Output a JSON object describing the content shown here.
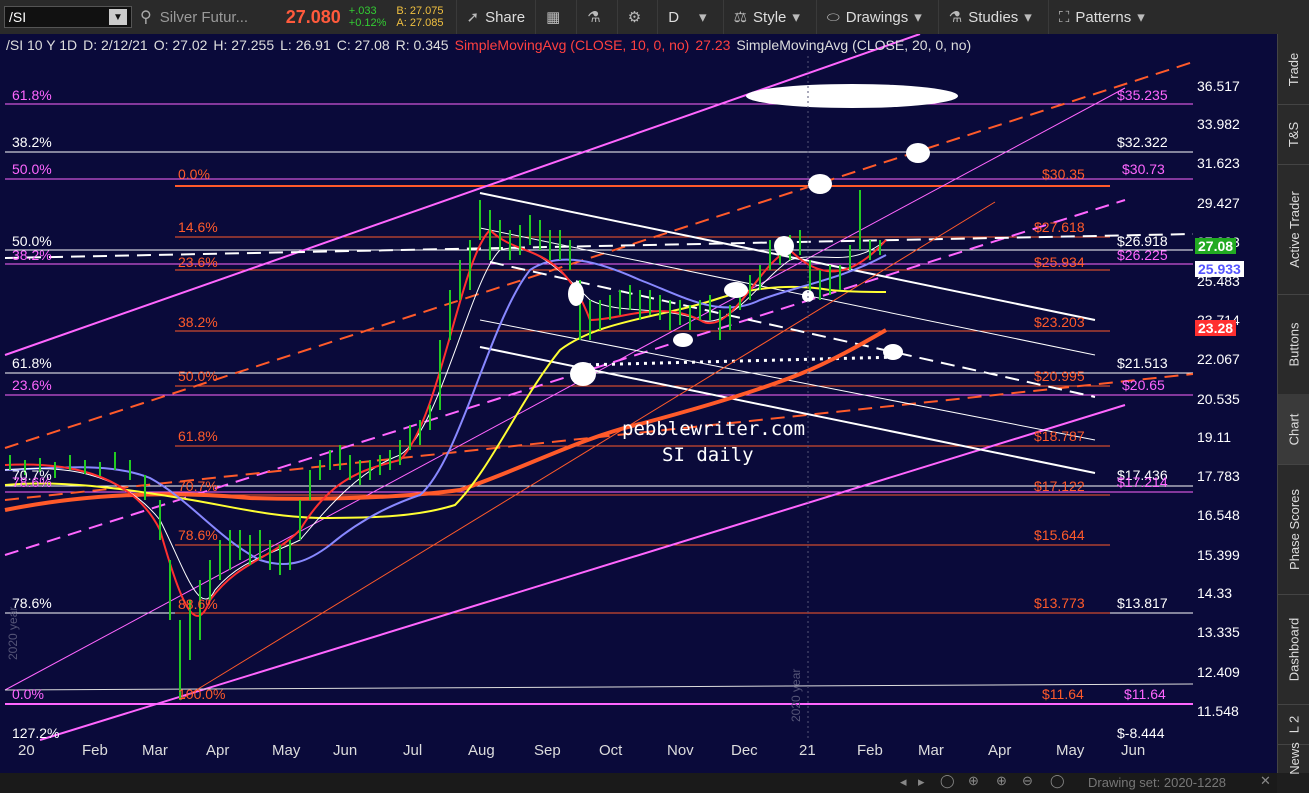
{
  "toolbar": {
    "symbol": "/SI",
    "description": "Silver Futur...",
    "last": "27.080",
    "change_abs": "+.033",
    "change_pct": "+0.12%",
    "bid": "B: 27.075",
    "ask": "A: 27.085",
    "share": "Share",
    "aggregation": "D",
    "style": "Style",
    "drawings": "Drawings",
    "studies": "Studies",
    "patterns": "Patterns"
  },
  "header": {
    "symbol_period": "/SI 10 Y 1D",
    "date": "D: 2/12/21",
    "open": "O: 27.02",
    "high": "H: 27.255",
    "low": "L: 26.91",
    "close": "C: 27.08",
    "range": "R: 0.345",
    "sma10": "SimpleMovingAvg (CLOSE, 10, 0, no)",
    "sma10_value": "27.23",
    "sma20": "SimpleMovingAvg (CLOSE, 20, 0, no)"
  },
  "yaxis": {
    "ticks": [
      "36.517",
      "33.982",
      "31.623",
      "29.427",
      "27.383",
      "25.483",
      "23.714",
      "22.067",
      "20.535",
      "19.11",
      "17.783",
      "16.548",
      "15.399",
      "14.33",
      "13.335",
      "12.409",
      "11.548"
    ],
    "last_tag": "27.08",
    "sma_tag": "25.933",
    "ma_tag": "23.28"
  },
  "xaxis": {
    "labels": [
      "20",
      "Feb",
      "Mar",
      "Apr",
      "May",
      "Jun",
      "Jul",
      "Aug",
      "Sep",
      "Oct",
      "Nov",
      "Dec",
      "21",
      "Feb",
      "Mar",
      "Apr",
      "May",
      "Jun"
    ],
    "year_marker_1": "2020 year",
    "year_marker_2": "2020 year"
  },
  "fib_left": {
    "l1": "61.8%",
    "l2": "38.2%",
    "l3": "50.0%",
    "l4": "50.0%",
    "l5": "38.2%",
    "l6": "61.8%",
    "l7": "23.6%",
    "l8": "78.6%",
    "l9": "0.0%",
    "l10": "127.2%",
    "l11": "70.7%",
    "l12": "78.6%"
  },
  "fib_mid": {
    "m1": "0.0%",
    "m2": "14.6%",
    "m3": "23.6%",
    "m4": "38.2%",
    "m5": "50.0%",
    "m6": "61.8%",
    "m7": "70.7%",
    "m8": "78.6%",
    "m9": "88.6%",
    "m10": "100.0%"
  },
  "fib_right": {
    "r1": "$35.235",
    "r2": "$32.322",
    "r3": "$30.35",
    "r4": "$30.73",
    "r5": "$27.618",
    "r6": "$26.918",
    "r7": "$26.225",
    "r8": "$25.934",
    "r9": "$23.203",
    "r10": "$21.513",
    "r11": "$20.995",
    "r12": "$20.65",
    "r13": "$18.787",
    "r14": "$17.436",
    "r15": "$17.122",
    "r16": "$17.214",
    "r17": "$15.644",
    "r18": "$13.773",
    "r19": "$13.817",
    "r20": "$11.64",
    "r21": "$11.64",
    "r22": "$-8.444"
  },
  "watermark": {
    "line1": "pebblewriter.com",
    "line2": "SI daily"
  },
  "sidebar": {
    "tabs": [
      "Trade",
      "T&S",
      "Active Trader",
      "Buttons",
      "Chart",
      "Phase Scores",
      "Dashboard",
      "L 2",
      "News"
    ]
  },
  "bottom": {
    "drawing_set": "Drawing set: 2020-1228"
  },
  "colors": {
    "background": "#0a0a3a",
    "fib_orange": "#ff5a2a",
    "fib_pink": "#ff66ff",
    "sma_yellow": "#ffff33",
    "sma_blue": "#8888ff",
    "last_green": "#22aa22"
  }
}
